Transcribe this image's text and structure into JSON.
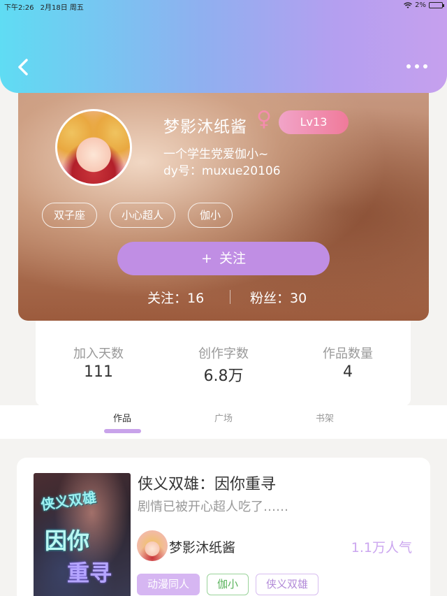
{
  "status_bar": {
    "time": "下午2:26",
    "date": "2月18日 周五",
    "battery": "2%"
  },
  "profile": {
    "name": "梦影沐纸酱",
    "gender_symbol": "♀",
    "level": "Lv13",
    "bio": "一个学生党爱伽小~",
    "dy_id": "dy号：muxue20106",
    "tags": [
      "双子座",
      "小心超人",
      "伽小"
    ],
    "follow_button": {
      "plus": "+",
      "label": "关注"
    },
    "following": "关注：16",
    "fans": "粉丝：30"
  },
  "counts": [
    {
      "label": "加入天数",
      "value": "111"
    },
    {
      "label": "创作字数",
      "value": "6.8万"
    },
    {
      "label": "作品数量",
      "value": "4"
    }
  ],
  "tabs": [
    {
      "label": "作品",
      "active": true
    },
    {
      "label": "广场",
      "active": false
    },
    {
      "label": "书架",
      "active": false
    }
  ],
  "book": {
    "title": "侠义双雄：因你重寻",
    "description": "剧情已被开心超人吃了……",
    "author": "梦影沐纸酱",
    "popularity": "1.1万人气",
    "tags": [
      "动漫同人",
      "伽小",
      "侠义双雄"
    ],
    "cover_text": [
      "侠义双雄",
      "因你",
      "重寻"
    ]
  },
  "colors": {
    "accent": "#c08ee4",
    "header_start": "#5fdcf3",
    "header_end": "#c6a0ee",
    "level_badge": "#f07a9a",
    "popularity": "#cba6ef"
  },
  "icons": {
    "back": "back-arrow-icon",
    "more": "more-dots-icon",
    "gender": "female-icon",
    "wifi": "wifi-icon",
    "battery": "battery-icon"
  }
}
